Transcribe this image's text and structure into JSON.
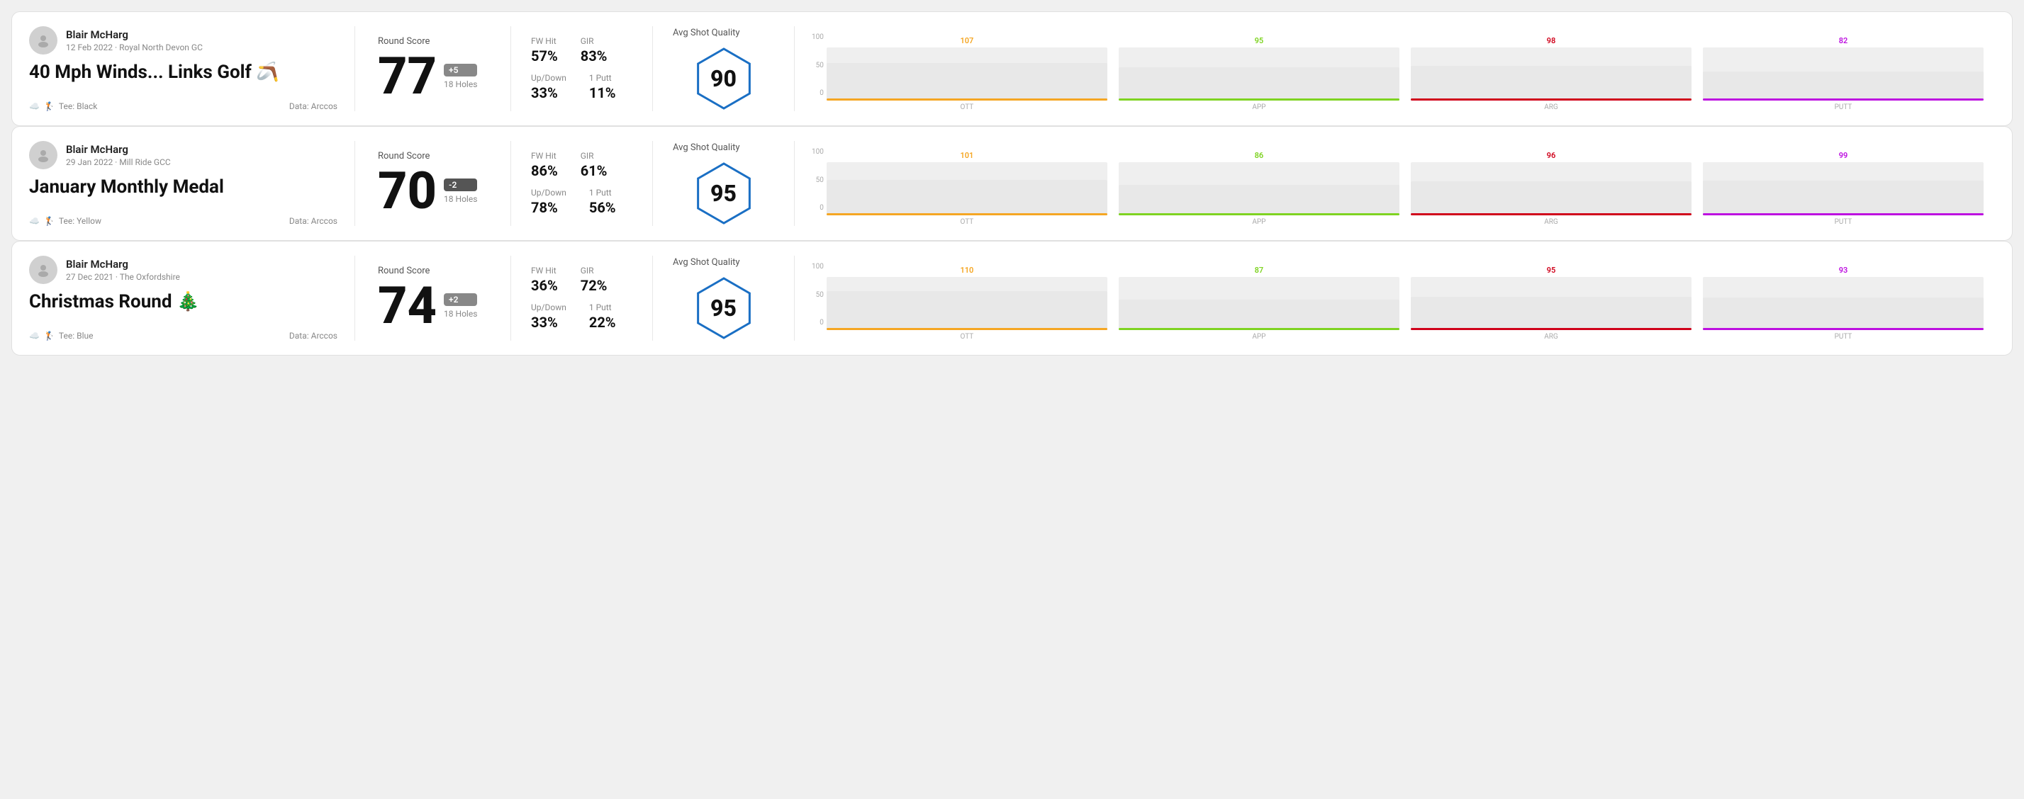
{
  "rounds": [
    {
      "id": "round1",
      "user": {
        "name": "Blair McHarg",
        "date_course": "12 Feb 2022 · Royal North Devon GC"
      },
      "title": "40 Mph Winds... Links Golf 🪃",
      "tee": "Black",
      "data_source": "Data: Arccos",
      "score": {
        "value": "77",
        "modifier": "+5",
        "holes": "18 Holes",
        "modifier_type": "positive"
      },
      "stats": {
        "fw_hit": "57%",
        "gir": "83%",
        "up_down": "33%",
        "one_putt": "11%"
      },
      "quality": {
        "label": "Avg Shot Quality",
        "value": "90"
      },
      "chart": {
        "bars": [
          {
            "label": "OTT",
            "value": 107,
            "color": "#f5a623",
            "height_pct": 71
          },
          {
            "label": "APP",
            "value": 95,
            "color": "#7ed321",
            "height_pct": 63
          },
          {
            "label": "ARG",
            "value": 98,
            "color": "#d0021b",
            "height_pct": 65
          },
          {
            "label": "PUTT",
            "value": 82,
            "color": "#bd10e0",
            "height_pct": 55
          }
        ],
        "y_labels": [
          "100",
          "50",
          "0"
        ]
      }
    },
    {
      "id": "round2",
      "user": {
        "name": "Blair McHarg",
        "date_course": "29 Jan 2022 · Mill Ride GCC"
      },
      "title": "January Monthly Medal",
      "tee": "Yellow",
      "data_source": "Data: Arccos",
      "score": {
        "value": "70",
        "modifier": "-2",
        "holes": "18 Holes",
        "modifier_type": "negative"
      },
      "stats": {
        "fw_hit": "86%",
        "gir": "61%",
        "up_down": "78%",
        "one_putt": "56%"
      },
      "quality": {
        "label": "Avg Shot Quality",
        "value": "95"
      },
      "chart": {
        "bars": [
          {
            "label": "OTT",
            "value": 101,
            "color": "#f5a623",
            "height_pct": 67
          },
          {
            "label": "APP",
            "value": 86,
            "color": "#7ed321",
            "height_pct": 57
          },
          {
            "label": "ARG",
            "value": 96,
            "color": "#d0021b",
            "height_pct": 64
          },
          {
            "label": "PUTT",
            "value": 99,
            "color": "#bd10e0",
            "height_pct": 66
          }
        ],
        "y_labels": [
          "100",
          "50",
          "0"
        ]
      }
    },
    {
      "id": "round3",
      "user": {
        "name": "Blair McHarg",
        "date_course": "27 Dec 2021 · The Oxfordshire"
      },
      "title": "Christmas Round 🎄",
      "tee": "Blue",
      "data_source": "Data: Arccos",
      "score": {
        "value": "74",
        "modifier": "+2",
        "holes": "18 Holes",
        "modifier_type": "positive"
      },
      "stats": {
        "fw_hit": "36%",
        "gir": "72%",
        "up_down": "33%",
        "one_putt": "22%"
      },
      "quality": {
        "label": "Avg Shot Quality",
        "value": "95"
      },
      "chart": {
        "bars": [
          {
            "label": "OTT",
            "value": 110,
            "color": "#f5a623",
            "height_pct": 73
          },
          {
            "label": "APP",
            "value": 87,
            "color": "#7ed321",
            "height_pct": 58
          },
          {
            "label": "ARG",
            "value": 95,
            "color": "#d0021b",
            "height_pct": 63
          },
          {
            "label": "PUTT",
            "value": 93,
            "color": "#bd10e0",
            "height_pct": 62
          }
        ],
        "y_labels": [
          "100",
          "50",
          "0"
        ]
      }
    }
  ],
  "labels": {
    "round_score": "Round Score",
    "fw_hit": "FW Hit",
    "gir": "GIR",
    "up_down": "Up/Down",
    "one_putt": "1 Putt",
    "avg_shot_quality": "Avg Shot Quality",
    "tee_prefix": "Tee: ",
    "holes": "18 Holes"
  }
}
